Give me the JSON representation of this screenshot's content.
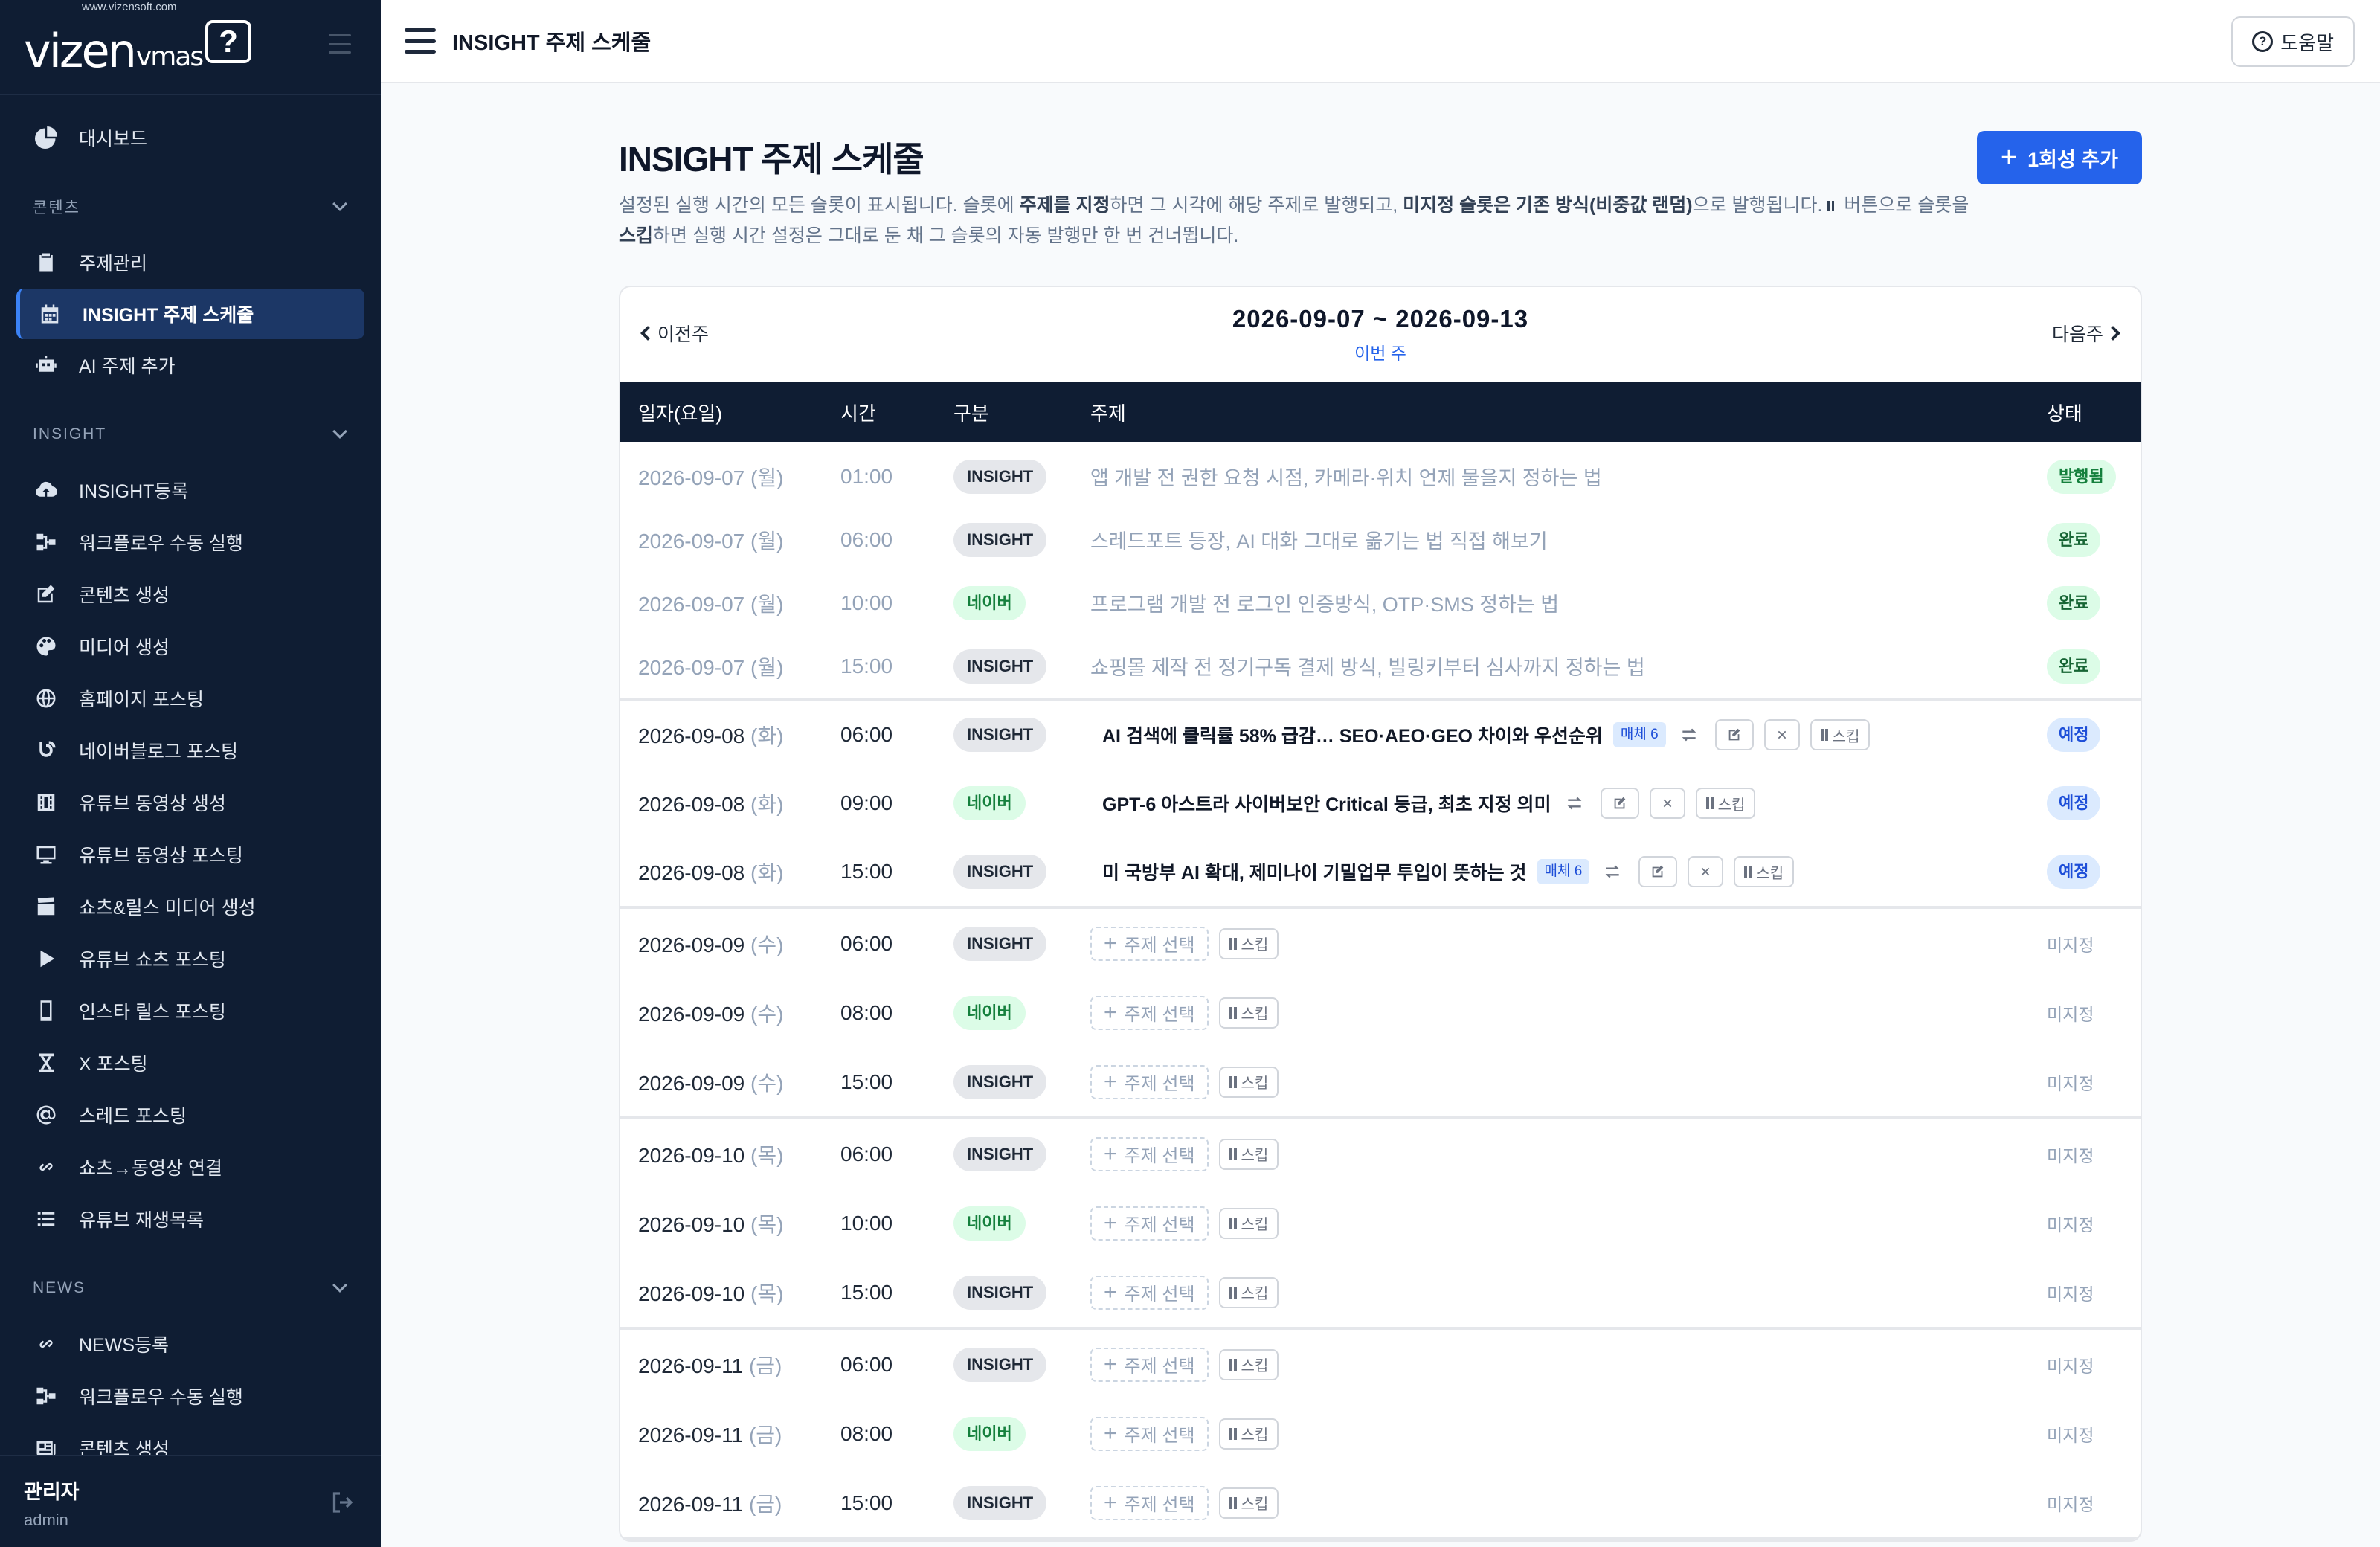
{
  "brand": {
    "logo_main": "vizen",
    "logo_sub": "vmas",
    "logo_url": "www.vizensoft.com",
    "logo_mark": "?"
  },
  "sidebar": {
    "items_top": [
      {
        "label": "대시보드",
        "icon": "pie-chart-icon"
      }
    ],
    "sections": [
      {
        "title": "콘텐츠",
        "items": [
          {
            "label": "주제관리",
            "icon": "clipboard-icon"
          },
          {
            "label": "INSIGHT 주제 스케줄",
            "icon": "calendar-icon",
            "active": true
          },
          {
            "label": "AI 주제 추가",
            "icon": "robot-icon"
          }
        ]
      },
      {
        "title": "INSIGHT",
        "items": [
          {
            "label": "INSIGHT등록",
            "icon": "cloud-upload-icon"
          },
          {
            "label": "워크플로우 수동 실행",
            "icon": "workflow-icon"
          },
          {
            "label": "콘텐츠 생성",
            "icon": "edit-icon"
          },
          {
            "label": "미디어 생성",
            "icon": "palette-icon"
          },
          {
            "label": "홈페이지 포스팅",
            "icon": "globe-icon"
          },
          {
            "label": "네이버블로그 포스팅",
            "icon": "blog-icon"
          },
          {
            "label": "유튜브 동영상 생성",
            "icon": "film-icon"
          },
          {
            "label": "유튜브 동영상 포스팅",
            "icon": "monitor-icon"
          },
          {
            "label": "쇼츠&릴스 미디어 생성",
            "icon": "clapperboard-icon"
          },
          {
            "label": "유튜브 쇼츠 포스팅",
            "icon": "play-icon"
          },
          {
            "label": "인스타 릴스 포스팅",
            "icon": "mobile-icon"
          },
          {
            "label": "X 포스팅",
            "icon": "x-logo-icon"
          },
          {
            "label": "스레드 포스팅",
            "icon": "at-sign-icon"
          },
          {
            "label": "쇼츠→동영상 연결",
            "icon": "link-icon"
          },
          {
            "label": "유튜브 재생목록",
            "icon": "list-icon"
          }
        ]
      },
      {
        "title": "NEWS",
        "items": [
          {
            "label": "NEWS등록",
            "icon": "link-icon"
          },
          {
            "label": "워크플로우 수동 실행",
            "icon": "workflow-icon"
          },
          {
            "label": "콘텐츠 생성",
            "icon": "newspaper-icon"
          }
        ]
      }
    ],
    "user": {
      "name": "관리자",
      "role": "admin"
    }
  },
  "topbar": {
    "title": "INSIGHT 주제 스케줄",
    "help": "도움말"
  },
  "page": {
    "title": "INSIGHT 주제 스케줄",
    "add_button": "1회성 추가",
    "desc_parts": [
      "설정된 실행 시간의 모든 슬롯이 표시됩니다. 슬롯에 ",
      "주제를 지정",
      "하면 그 시각에 해당 주제로 발행되고, ",
      "미지정 슬롯은 기존 방식(비중값 랜덤)",
      "으로 발행됩니다. ",
      " 버튼으로 슬롯을 ",
      "스킵",
      "하면 실행 시간 설정은 그대로 둔 채 그 슬롯의 자동 발행만 한 번 건너뜁니다."
    ]
  },
  "week": {
    "prev": "이전주",
    "next": "다음주",
    "range": "2026-09-07 ~ 2026-09-13",
    "current": "이번 주"
  },
  "table": {
    "headers": {
      "date": "일자(요일)",
      "time": "시간",
      "type": "구분",
      "topic": "주제",
      "status": "상태"
    },
    "labels": {
      "pick": "주제 선택",
      "skip": "스킵",
      "media": "매체 6"
    },
    "groups": [
      {
        "kind": "done",
        "rows": [
          {
            "date": "2026-09-07",
            "dow": "(월)",
            "time": "01:00",
            "type": "INSIGHT",
            "topic": "앱 개발 전 권한 요청 시점, 카메라·위치 언제 물을지 정하는 법",
            "status": "발행됨",
            "status_kind": "pub"
          },
          {
            "date": "2026-09-07",
            "dow": "(월)",
            "time": "06:00",
            "type": "INSIGHT",
            "topic": "스레드포트 등장, AI 대화 그대로 옮기는 법 직접 해보기",
            "status": "완료",
            "status_kind": "done"
          },
          {
            "date": "2026-09-07",
            "dow": "(월)",
            "time": "10:00",
            "type": "네이버",
            "topic": "프로그램 개발 전 로그인 인증방식, OTP·SMS 정하는 법",
            "status": "완료",
            "status_kind": "done"
          },
          {
            "date": "2026-09-07",
            "dow": "(월)",
            "time": "15:00",
            "type": "INSIGHT",
            "topic": "쇼핑몰 제작 전 정기구독 결제 방식, 빌링키부터 심사까지 정하는 법",
            "status": "완료",
            "status_kind": "done"
          }
        ]
      },
      {
        "kind": "set",
        "rows": [
          {
            "date": "2026-09-08",
            "dow": "(화)",
            "time": "06:00",
            "type": "INSIGHT",
            "topic": "AI 검색에 클릭률 58% 급감… SEO·AEO·GEO 차이와 우선순위",
            "media": true,
            "status": "예정",
            "status_kind": "plan"
          },
          {
            "date": "2026-09-08",
            "dow": "(화)",
            "time": "09:00",
            "type": "네이버",
            "topic": "GPT-6 아스트라 사이버보안 Critical 등급, 최초 지정 의미",
            "media": false,
            "status": "예정",
            "status_kind": "plan"
          },
          {
            "date": "2026-09-08",
            "dow": "(화)",
            "time": "15:00",
            "type": "INSIGHT",
            "topic": "미 국방부 AI 확대, 제미나이 기밀업무 투입이 뜻하는 것",
            "media": true,
            "status": "예정",
            "status_kind": "plan"
          }
        ]
      },
      {
        "kind": "empty",
        "rows": [
          {
            "date": "2026-09-09",
            "dow": "(수)",
            "time": "06:00",
            "type": "INSIGHT",
            "status": "미지정"
          },
          {
            "date": "2026-09-09",
            "dow": "(수)",
            "time": "08:00",
            "type": "네이버",
            "status": "미지정"
          },
          {
            "date": "2026-09-09",
            "dow": "(수)",
            "time": "15:00",
            "type": "INSIGHT",
            "status": "미지정"
          }
        ]
      },
      {
        "kind": "empty",
        "rows": [
          {
            "date": "2026-09-10",
            "dow": "(목)",
            "time": "06:00",
            "type": "INSIGHT",
            "status": "미지정"
          },
          {
            "date": "2026-09-10",
            "dow": "(목)",
            "time": "10:00",
            "type": "네이버",
            "status": "미지정"
          },
          {
            "date": "2026-09-10",
            "dow": "(목)",
            "time": "15:00",
            "type": "INSIGHT",
            "status": "미지정"
          }
        ]
      },
      {
        "kind": "empty",
        "rows": [
          {
            "date": "2026-09-11",
            "dow": "(금)",
            "time": "06:00",
            "type": "INSIGHT",
            "status": "미지정"
          },
          {
            "date": "2026-09-11",
            "dow": "(금)",
            "time": "08:00",
            "type": "네이버",
            "status": "미지정"
          },
          {
            "date": "2026-09-11",
            "dow": "(금)",
            "time": "15:00",
            "type": "INSIGHT",
            "status": "미지정"
          }
        ]
      }
    ]
  },
  "colors": {
    "sidebar_bg": "#0f1d33",
    "accent": "#2563eb",
    "naver_green": "#15803d"
  }
}
